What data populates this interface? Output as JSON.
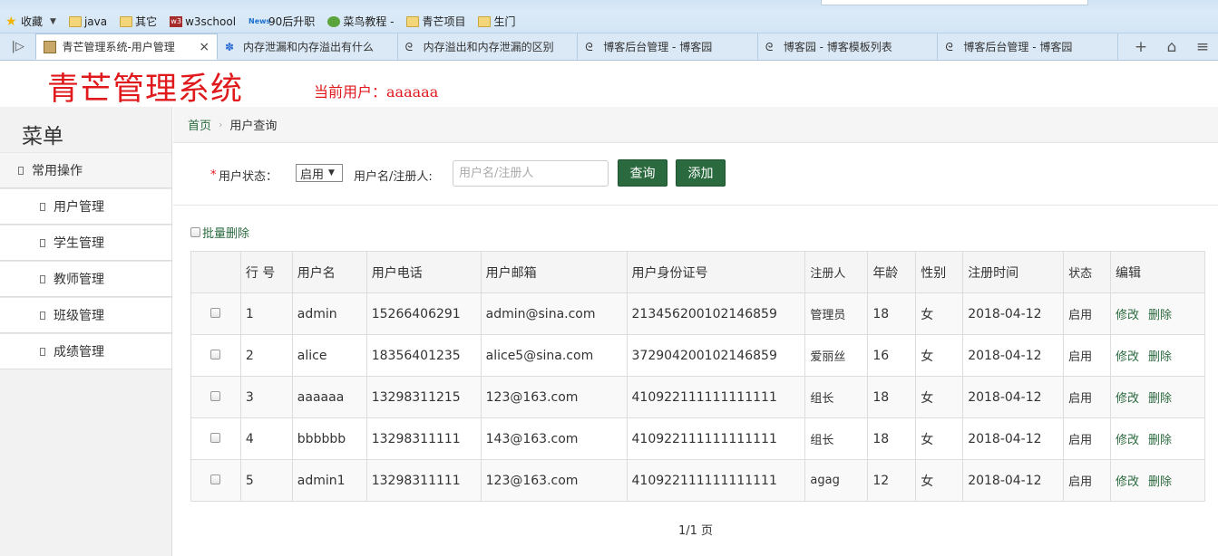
{
  "browser": {
    "bookmarks": [
      {
        "label": "收藏",
        "icon": "star-icon",
        "has_arrow": true
      },
      {
        "label": "java",
        "icon": "folder-icon"
      },
      {
        "label": "其它",
        "icon": "folder-icon"
      },
      {
        "label": "w3school",
        "icon": "w3school-icon"
      },
      {
        "label": "90后升职",
        "icon": "news-icon"
      },
      {
        "label": "菜鸟教程 -",
        "icon": "runoob-icon"
      },
      {
        "label": "青芒项目",
        "icon": "folder-icon"
      },
      {
        "label": "生门",
        "icon": "folder-icon"
      }
    ],
    "tabs": [
      {
        "label": "青芒管理系统-用户管理",
        "active": true
      },
      {
        "label": "内存泄漏和内存溢出有什么",
        "active": false
      },
      {
        "label": "内存溢出和内存泄漏的区别",
        "active": false
      },
      {
        "label": "博客后台管理 - 博客园",
        "active": false
      },
      {
        "label": "博客园 - 博客模板列表",
        "active": false
      },
      {
        "label": "博客后台管理 - 博客园",
        "active": false
      }
    ]
  },
  "header": {
    "title": "青芒管理系统",
    "current_user": "当前用户：aaaaaa"
  },
  "sidebar": {
    "title": "菜单",
    "group": "常用操作",
    "items": [
      "用户管理",
      "学生管理",
      "教师管理",
      "班级管理",
      "成绩管理"
    ]
  },
  "breadcrumb": {
    "home": "首页",
    "current": "用户查询"
  },
  "search": {
    "status_label": "用户状态：",
    "status_value": "启用",
    "name_label": "用户名/注册人:",
    "name_placeholder": "用户名/注册人",
    "query_button": "查询",
    "add_button": "添加"
  },
  "batch_delete": "批量删除",
  "table": {
    "headers": [
      "",
      "行 号",
      "用户名",
      "用户电话",
      "用户邮箱",
      "用户身份证号",
      "注册人",
      "年龄",
      "性别",
      "注册时间",
      "状态",
      "编辑"
    ],
    "rows": [
      [
        "1",
        "admin",
        "15266406291",
        "admin@sina.com",
        "213456200102146859",
        "管理员",
        "18",
        "女",
        "2018-04-12",
        "启用"
      ],
      [
        "2",
        "alice",
        "18356401235",
        "alice5@sina.com",
        "372904200102146859",
        "爱丽丝",
        "16",
        "女",
        "2018-04-12",
        "启用"
      ],
      [
        "3",
        "aaaaaa",
        "13298311215",
        "123@163.com",
        "410922111111111111",
        "组长",
        "18",
        "女",
        "2018-04-12",
        "启用"
      ],
      [
        "4",
        "bbbbbb",
        "13298311111",
        "143@163.com",
        "410922111111111111",
        "组长",
        "18",
        "女",
        "2018-04-12",
        "启用"
      ],
      [
        "5",
        "admin1",
        "13298311111",
        "123@163.com",
        "410922111111111111",
        "agag",
        "12",
        "女",
        "2018-04-12",
        "启用"
      ]
    ],
    "edit_label": "修改",
    "delete_label": "删除"
  },
  "pagination": "1/1 页",
  "colors": {
    "brand_red": "#e0191d",
    "action_green": "#2b6a3f"
  }
}
